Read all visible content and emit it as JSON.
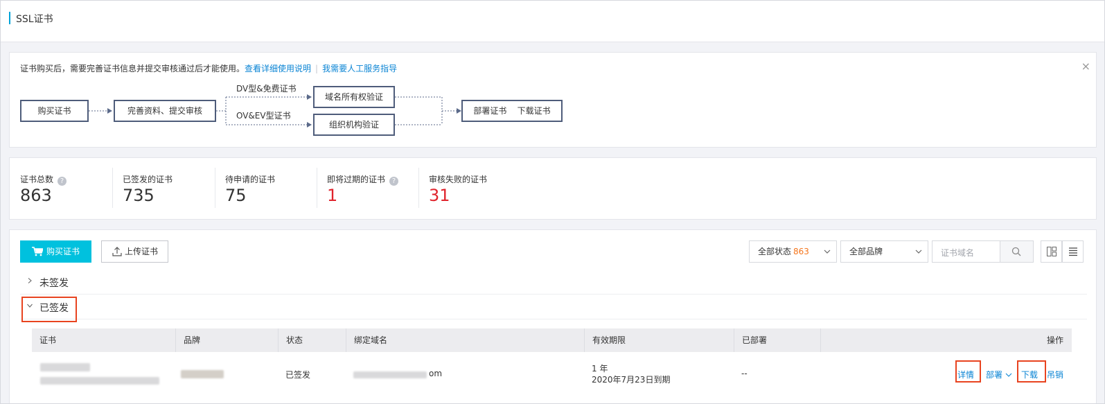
{
  "page": {
    "title": "SSL证书"
  },
  "notice": {
    "text": "证书购买后，需要完善证书信息并提交审核通过后才能使用。",
    "link_guide": "查看详细使用说明",
    "separator": "|",
    "link_service": "我需要人工服务指导"
  },
  "flow": {
    "step_buy": "购买证书",
    "step_complete": "完善资料、提交审核",
    "branch_dv": "DV型&免费证书",
    "branch_ov": "OV&EV型证书",
    "step_domain": "域名所有权验证",
    "step_org": "组织机构验证",
    "step_deploy": "部署证书",
    "step_download": "下载证书"
  },
  "stats": [
    {
      "label": "证书总数",
      "value": "863",
      "help": true,
      "color": "#333333"
    },
    {
      "label": "已签发的证书",
      "value": "735",
      "help": false,
      "color": "#333333"
    },
    {
      "label": "待申请的证书",
      "value": "75",
      "help": false,
      "color": "#333333"
    },
    {
      "label": "即将过期的证书",
      "value": "1",
      "help": true,
      "color": "#e0232c"
    },
    {
      "label": "审核失败的证书",
      "value": "31",
      "help": false,
      "color": "#e0232c"
    }
  ],
  "toolbar": {
    "buy_label": "购买证书",
    "upload_label": "上传证书",
    "status_filter": "全部状态",
    "status_count": "863",
    "brand_filter": "全部品牌",
    "search_placeholder": "证书域名"
  },
  "groups": {
    "unsigned": "未签发",
    "signed": "已签发"
  },
  "table": {
    "columns": [
      "证书",
      "品牌",
      "状态",
      "绑定域名",
      "有效期限",
      "已部署",
      "操作"
    ],
    "rows": [
      {
        "status": "已签发",
        "domain_suffix": "om",
        "validity": "1 年",
        "expiry": "2020年7月23日到期",
        "deployed": "--",
        "actions": {
          "detail": "详情",
          "deploy": "部署",
          "download": "下载",
          "revoke": "吊销"
        }
      }
    ]
  },
  "colors": {
    "accent": "#00c1de",
    "link": "#0a84d4",
    "danger": "#e0232c",
    "highlight_box": "#e8431f",
    "count": "#f5751b"
  }
}
